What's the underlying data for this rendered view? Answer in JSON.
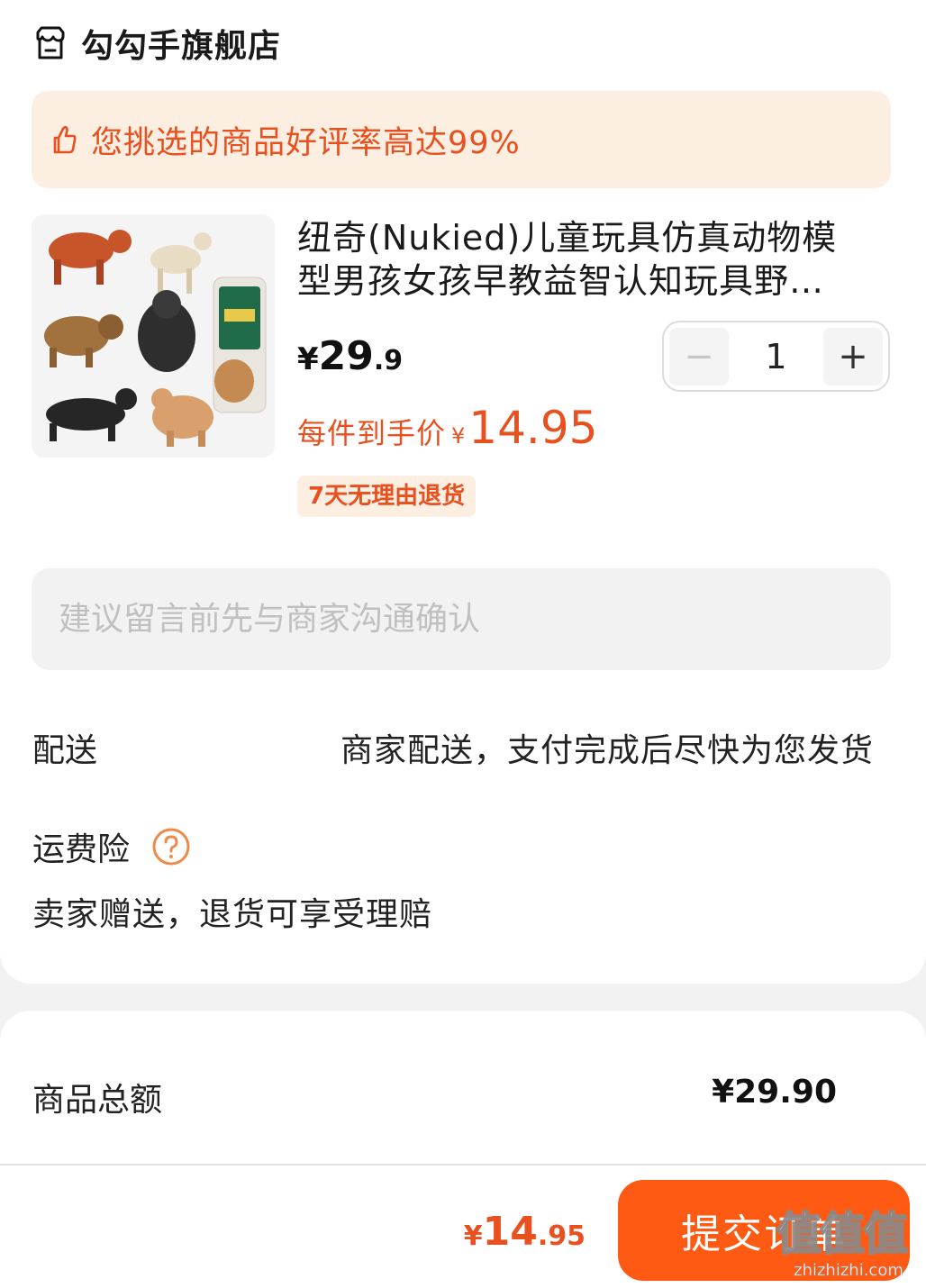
{
  "shop": {
    "name": "勾勾手旗舰店",
    "icon": "store-icon"
  },
  "promo": {
    "icon": "thumbs-up-icon",
    "text": "您挑选的商品好评率高达99%"
  },
  "product": {
    "title": "纽奇(Nukied)儿童玩具仿真动物模型男孩女孩早教益智认知玩具野…",
    "price": {
      "yen": "¥",
      "int": "29",
      "dec": ".9"
    },
    "quantity": {
      "value": "1",
      "minus": "−",
      "plus": "+"
    },
    "final_price": {
      "label": "每件到手价",
      "yen": "¥",
      "value": "14.95"
    },
    "badge": "7天无理由退货"
  },
  "message": {
    "placeholder": "建议留言前先与商家沟通确认"
  },
  "delivery": {
    "label": "配送",
    "value": "商家配送，支付完成后尽快为您发货"
  },
  "insurance": {
    "label": "运费险",
    "icon": "question-circle-icon",
    "desc": "卖家赠送，退货可享受理赔"
  },
  "summary": {
    "total_label": "商品总额",
    "total_value": "¥29.90"
  },
  "bottom": {
    "total": {
      "yen": "¥",
      "int": "14",
      "dec": ".95"
    },
    "submit_label": "提交订单"
  },
  "watermark": {
    "logo": "值值值",
    "url": "zhizhizhi.com"
  },
  "colors": {
    "accent": "#e8501f",
    "button": "#fe5a14",
    "banner_bg": "#fdeee2"
  }
}
